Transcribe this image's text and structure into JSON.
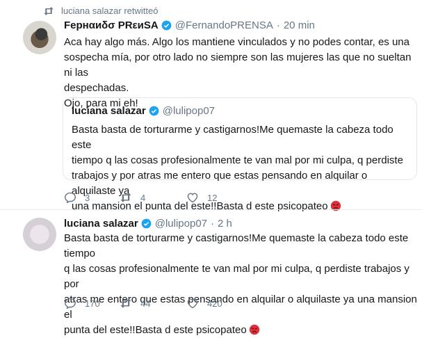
{
  "retweet_notice": "luciana salazar retwitteó",
  "tweet1": {
    "author_name": "Fернαиδσ PRεиSA",
    "handle": "@FernandoPRENSA",
    "separator": "·",
    "time": "20 min",
    "line1": "Aca hay algo más. Algo los mantiene vinculados y no podes contar, es una",
    "line2": "sospecha mía, por otro lado no siempre son las mujeres las que no sueltan ni las",
    "line3": "despechadas.",
    "line4": "Ojo, para mi eh!",
    "quote": {
      "author_name": "luciana salazar",
      "handle": "@lulipop07",
      "line1": "Basta basta de torturarme y castigarnos!Me quemaste la cabeza todo este",
      "line2": "tiempo q las cosas profesionalmente te van mal por mi culpa, q perdiste",
      "line3": "trabajos y por atras me entero que estas pensando en alquilar o alquilaste ya",
      "line4": "una mansion el punta del este!!Basta d este psicopateo"
    },
    "replies": "3",
    "retweets": "4",
    "likes": "12"
  },
  "tweet2": {
    "author_name": "luciana salazar",
    "handle": "@lulipop07",
    "separator": "·",
    "time": "2 h",
    "line1": "Basta basta de torturarme y castigarnos!Me quemaste la cabeza todo este tiempo",
    "line2": "q las cosas profesionalmente te van mal por mi culpa, q perdiste trabajos y por",
    "line3": "atras me entero que estas pensando en alquilar o alquilaste ya una mansion el",
    "line4": "punta del este!!Basta d este psicopateo",
    "replies": "170",
    "retweets": "44",
    "likes": "420"
  },
  "colors": {
    "verified": "#1da1f2",
    "muted": "#657786",
    "angry_face": "#e0303c"
  },
  "icons": [
    "retweet-icon",
    "verified-icon",
    "reply-icon",
    "like-icon",
    "angry-face-emoji"
  ]
}
